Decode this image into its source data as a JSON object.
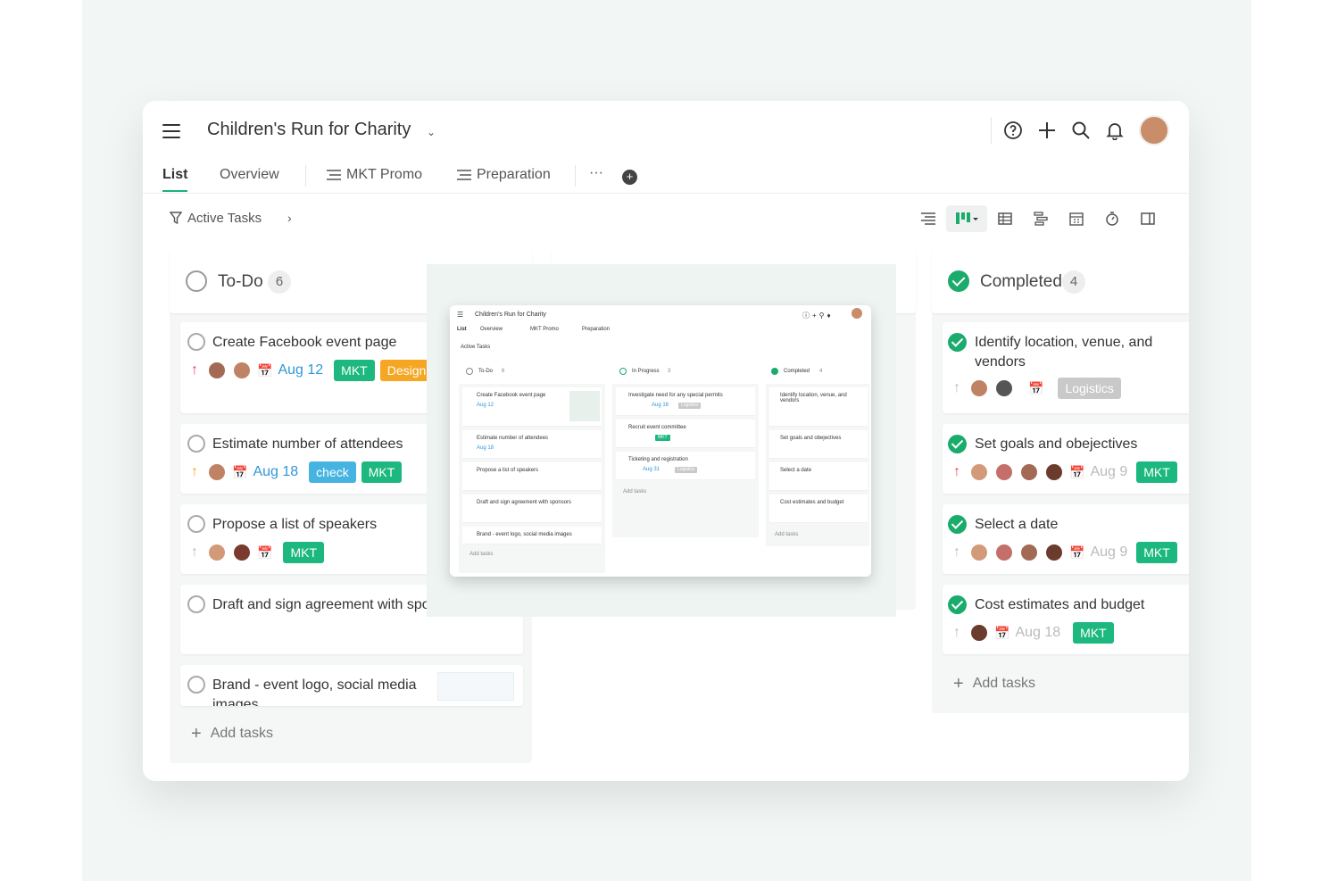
{
  "project": {
    "title": "Children's Run for Charity"
  },
  "tabs": [
    {
      "label": "List"
    },
    {
      "label": "Overview"
    },
    {
      "label": "MKT Promo"
    },
    {
      "label": "Preparation"
    },
    {
      "label": "···"
    }
  ],
  "filter": {
    "label": "Active Tasks"
  },
  "colors": {
    "accent": "#1aab6d",
    "mkt": "#1db87f",
    "design": "#f5a623",
    "check": "#46b4e0",
    "logistics": "#c9c9c9",
    "priority_high": "#e8445a",
    "priority_med": "#f5a623"
  },
  "columns": {
    "todo": {
      "name": "To-Do",
      "count": "6",
      "cards": [
        {
          "title": "Create Facebook event page",
          "date": "Aug 12",
          "tags": [
            "MKT",
            "Design"
          ]
        },
        {
          "title": "Estimate number of attendees",
          "date": "Aug 18",
          "tags": [
            "check",
            "MKT"
          ]
        },
        {
          "title": "Propose a list of speakers",
          "tags": [
            "MKT"
          ]
        },
        {
          "title": "Draft and sign agreement with sponsors"
        },
        {
          "title": "Brand - event logo, social media images"
        }
      ],
      "add_label": "Add tasks"
    },
    "inprogress": {
      "name": "In Progress",
      "count": "3",
      "cards": [
        {
          "title": "Investigate need for any special permits",
          "date": "Aug 16",
          "tags": [
            "Logistics"
          ]
        },
        {
          "title": "Recruit event committee",
          "tags": [
            "MKT"
          ]
        },
        {
          "title": "Ticketing and registration",
          "date": "Aug 31",
          "tags": [
            "Logistics"
          ]
        }
      ],
      "add_label": "Add tasks"
    },
    "completed": {
      "name": "Completed",
      "count": "4",
      "cards": [
        {
          "title": "Identify location, venue, and vendors",
          "tags": [
            "Logistics"
          ]
        },
        {
          "title": "Set goals and obejectives",
          "date": "Aug 9",
          "tags": [
            "MKT"
          ]
        },
        {
          "title": "Select a date",
          "date": "Aug 9",
          "tags": [
            "MKT"
          ]
        },
        {
          "title": "Cost estimates and budget",
          "date": "Aug 18",
          "tags": [
            "MKT"
          ]
        }
      ],
      "add_label": "Add tasks"
    }
  }
}
